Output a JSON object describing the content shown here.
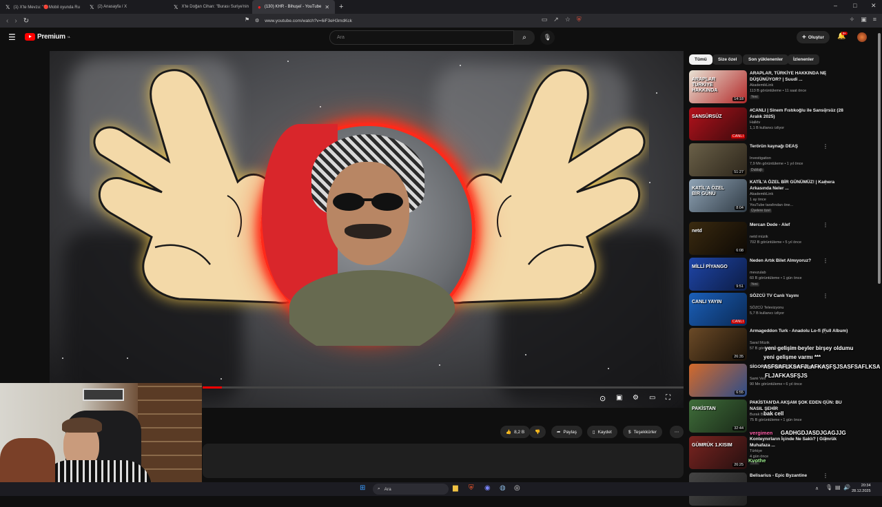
{
  "browser": {
    "tabs": [
      {
        "label": "(1) X'te Mevzu: \"🔴Mobil oyunda Ru",
        "icon": "X",
        "active": false
      },
      {
        "label": "(2) Anasayfa / X",
        "icon": "X",
        "active": false
      },
      {
        "label": "X'te Doğan Cihan: \"Burası Suriye'nin",
        "icon": "X",
        "active": false
      },
      {
        "label": "(130) KHR - Bihuşeî - YouTube",
        "icon": "▶",
        "active": true
      }
    ],
    "url": "www.youtube.com/watch?v=6iF3eH3mdKck"
  },
  "youtube": {
    "logo": "Premium",
    "logo_sup": "NL",
    "search_placeholder": "Ara",
    "create_label": "Oluştur",
    "notif_count": "9+"
  },
  "actions": {
    "likes": "8,2 B",
    "share": "Paylaş",
    "save": "Kaydet",
    "thanks": "Teşekkürler"
  },
  "chips": [
    "Tümü",
    "Size özel",
    "Son yüklenenler",
    "İzlenenler"
  ],
  "related": [
    {
      "title": "ARAPLAR, TÜRKİYE HAKKINDA NE DÜŞÜNÜYOR? | Suudi ...",
      "channel": "AkademikLink",
      "meta": "113 B görüntüleme • 11 saat önce",
      "badge": "Yeni",
      "duration": "14:18",
      "thumb_text": "ARAPLAR TÜRKİYE HAKKINDA",
      "color1": "#e8e2d4",
      "color2": "#b32a2a"
    },
    {
      "title": "#CANLI | Sinem Fıstıkoğlu ile Sansürsüz (28 Aralık 2025)",
      "channel": "Halktv",
      "meta": "1,1 B kullanıcı izliyor",
      "badge": "",
      "duration": "CANLI",
      "thumb_text": "SANSÜRSÜZ",
      "color1": "#b3121c",
      "color2": "#3b0a0c"
    },
    {
      "title": "Terörün kaynağı DEAŞ",
      "channel": "Investigation",
      "meta": "7,9 Mn görüntüleme • 1 yıl önce",
      "badge": "Dublajlı",
      "duration": "51:27",
      "thumb_text": "",
      "color1": "#6a6048",
      "color2": "#2d261b"
    },
    {
      "title": "KATİL'A ÖZEL BİR GÜNÜMÜZ! | Kamera Arkasında Neler ...",
      "channel": "AkademikLink",
      "meta": "1 ay önce",
      "badge": "Üyelere özel",
      "meta2": "YouTube tarafından öne...",
      "duration": "8:04",
      "thumb_text": "KATİL'A ÖZEL BİR GÜNÜ",
      "color1": "#8fa3b5",
      "color2": "#313c46"
    },
    {
      "title": "Mercan Dede - Alef",
      "channel": "netd müzik",
      "meta": "702 B görüntüleme • 5 yıl önce",
      "badge": "",
      "duration": "6:08",
      "thumb_text": "netd",
      "color1": "#3a2a10",
      "color2": "#0d0904"
    },
    {
      "title": "Neden Artık Bilet Almıyoruz?",
      "channel": "mevzulab",
      "meta": "60 B görüntüleme • 1 gün önce",
      "badge": "Yeni",
      "duration": "9:51",
      "thumb_text": "MİLLİ PİYANGO",
      "color1": "#1f46a8",
      "color2": "#0c1c45"
    },
    {
      "title": "SÖZCÜ TV Canlı Yayını",
      "channel": "SÖZCÜ Televizyonu",
      "meta": "5,7 B kullanıcı izliyor",
      "badge": "",
      "duration": "CANLI",
      "thumb_text": "CANLI YAYIN",
      "color1": "#1b5fb8",
      "color2": "#0a2a55"
    },
    {
      "title": "Armageddon Turk - Anadolu Lo-fi (Full Album)",
      "channel": "Saral Müzik",
      "meta": "57 B görüntüleme • 1 yıl önce",
      "badge": "",
      "duration": "26:35",
      "thumb_text": "",
      "color1": "#6b4a27",
      "color2": "#1a1208"
    },
    {
      "title": "SİGORTA ÖDEMEDİ #workingclass",
      "channel": "Sami Veli",
      "meta": "90 Mn görüntüleme • 6 yıl önce",
      "badge": "",
      "duration": "6:55",
      "thumb_text": "",
      "color1": "#d46a2a",
      "color2": "#2c4d8a"
    },
    {
      "title": "PAKİSTAN'DA AKŞAM ŞOK EDEN GÜN: BU NASIL ŞEHİR",
      "channel": "Burak Bozkurt",
      "meta": "75 B görüntüleme • 1 gün önce",
      "badge": "",
      "duration": "32:44",
      "thumb_text": "PAKİSTAN",
      "color1": "#3f6d3a",
      "color2": "#1a2a18"
    },
    {
      "title": "Konteynırların İçinde Ne Saklı? | Gümrük Muhafaza ...",
      "channel": "Türkiye",
      "meta": "4 gün önce",
      "badge": "Yeni",
      "duration": "26:25",
      "thumb_text": "GÜMRÜK 1.KISIM",
      "color1": "#7a2420",
      "color2": "#261010"
    },
    {
      "title": "Belisarius - Epic Byzantine",
      "channel": "",
      "meta": "",
      "badge": "",
      "duration": "",
      "thumb_text": "",
      "color1": "#444",
      "color2": "#222"
    }
  ],
  "chat": [
    {
      "name": "",
      "msg": "yeni gelişim beyler birşey oldumu",
      "color": "#ffffff"
    },
    {
      "name": "",
      "msg": "yeni gelişme varmı ***",
      "color": "#ffffff"
    },
    {
      "name": "",
      "msg": "ASFSAFLKSAFJLAFKAŞFŞJSASFSAFLKSA",
      "color": "#ffffff"
    },
    {
      "name": "",
      "msg": "FLJAFKASFŞJS",
      "color": "#ffffff"
    },
    {
      "name": "",
      "msg": "bak cell",
      "color": "#ffffff"
    },
    {
      "name": "vergimen",
      "msg": "GADHGDJASDJGAGJJG",
      "color": "#ff5ea8"
    },
    {
      "name": "Kvothe",
      "msg": "",
      "color": "#9ef08f"
    }
  ],
  "taskbar": {
    "search": "Ara",
    "time": "20:34",
    "date": "28.12.2025"
  },
  "colors": {
    "accent": "#ff0000",
    "bg": "#0f0f0f",
    "ring": "#ff2a1a"
  }
}
